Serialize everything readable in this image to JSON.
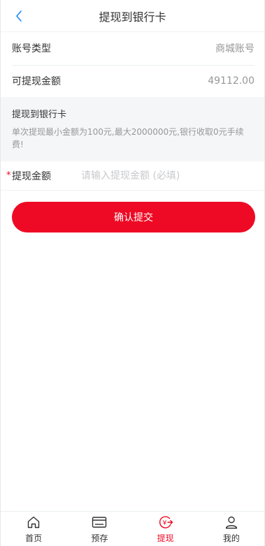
{
  "header": {
    "title": "提现到银行卡"
  },
  "account_type": {
    "label": "账号类型",
    "value": "商城账号"
  },
  "balance": {
    "label": "可提现金额",
    "value": "49112.00"
  },
  "notice": {
    "title": "提现到银行卡",
    "description": "单次提现最小金额为100元,最大2000000元,银行收取0元手续费!"
  },
  "amount_field": {
    "required_mark": "*",
    "label": "提现金额",
    "placeholder": "请输入提现金额 (必填)"
  },
  "submit": {
    "label": "确认提交"
  },
  "colors": {
    "accent": "#ee0a24",
    "back_icon": "#1989fa"
  },
  "tabbar": {
    "items": [
      {
        "label": "首页",
        "icon": "home-icon",
        "active": false
      },
      {
        "label": "预存",
        "icon": "wallet-icon",
        "active": false
      },
      {
        "label": "提现",
        "icon": "withdraw-icon",
        "active": true
      },
      {
        "label": "我的",
        "icon": "user-icon",
        "active": false
      }
    ]
  }
}
